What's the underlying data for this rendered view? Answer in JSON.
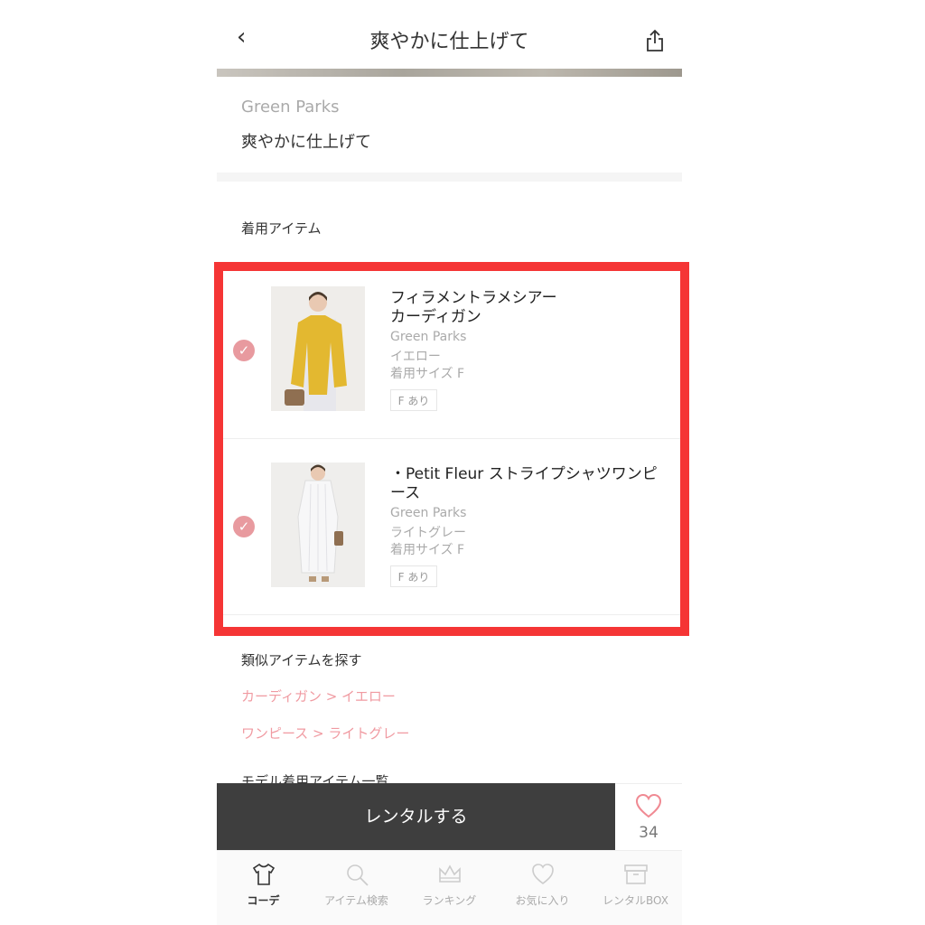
{
  "header": {
    "title": "爽やかに仕上げて",
    "back_glyph": "‹"
  },
  "coordinate": {
    "brand": "Green Parks",
    "title": "爽やかに仕上げて"
  },
  "items_section": {
    "heading": "着用アイテム",
    "items": [
      {
        "name": "フィラメントラメシアー\nカーディガン",
        "brand": "Green Parks",
        "color": "イエロー",
        "size": "着用サイズ  F",
        "tag": "F あり",
        "selected": true
      },
      {
        "name": "・Petit Fleur ストライプシャツワンピース",
        "brand": "Green Parks",
        "color": "ライトグレー",
        "size": "着用サイズ  F",
        "tag": "F あり",
        "selected": true
      }
    ]
  },
  "similar": {
    "heading": "類似アイテムを探す",
    "links": [
      "カーディガン > イエロー",
      "ワンピース > ライトグレー"
    ]
  },
  "model_heading": "モデル着用アイテム一覧",
  "actions": {
    "rent_label": "レンタルする",
    "favorite_count": "34"
  },
  "tabbar": {
    "tabs": [
      {
        "label": "コーデ",
        "icon": "tshirt-icon",
        "active": true
      },
      {
        "label": "アイテム検索",
        "icon": "search-icon",
        "active": false
      },
      {
        "label": "ランキング",
        "icon": "crown-icon",
        "active": false
      },
      {
        "label": "お気に入り",
        "icon": "heart-icon",
        "active": false
      },
      {
        "label": "レンタルBOX",
        "icon": "box-icon",
        "active": false
      }
    ]
  },
  "colors": {
    "accent_pink": "#f09aa1",
    "check_pink": "#e89a9f",
    "highlight_red": "#f53535",
    "button_dark": "#3e3e3e"
  }
}
